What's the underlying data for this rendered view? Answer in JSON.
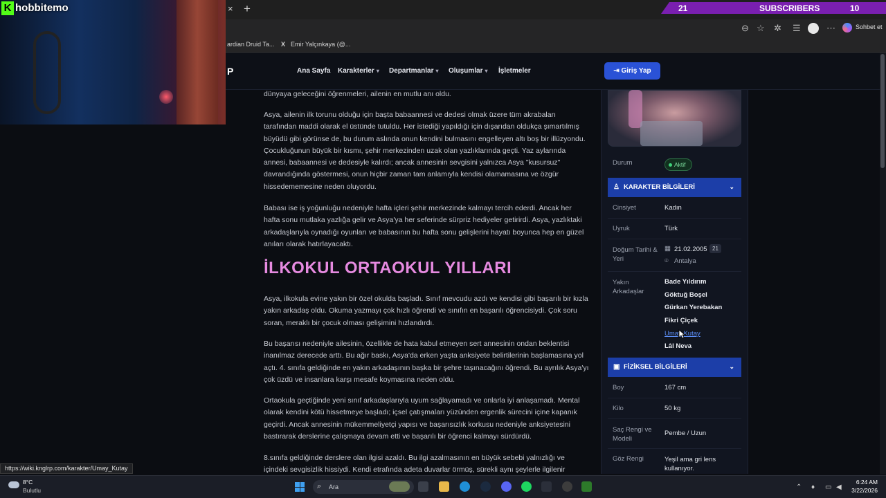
{
  "stream": {
    "channel": "hobbitemo",
    "banner": {
      "left": "21",
      "center": "SUBSCRIBERS",
      "right": "10"
    }
  },
  "browser": {
    "tab_close": "×",
    "tab_new": "+",
    "bookmarks": [
      "ardian Druid Ta...",
      "Emir Yalçınkaya (@..."
    ],
    "copilot_label": "Sohbet et",
    "status_url": "https://wiki.knglrp.com/karakter/Umay_Kutay"
  },
  "site": {
    "logo_fragment": "P",
    "nav": [
      {
        "label": "Ana Sayfa",
        "dropdown": false
      },
      {
        "label": "Karakterler",
        "dropdown": true
      },
      {
        "label": "Departmanlar",
        "dropdown": true
      },
      {
        "label": "Oluşumlar",
        "dropdown": true
      },
      {
        "label": "İşletmeler",
        "dropdown": false
      }
    ],
    "login_label": "Giriş Yap"
  },
  "article": {
    "paragraphs_top": [
      "dünyaya geleceğini öğrenmeleri, ailenin en mutlu anı oldu.",
      "Asya, ailenin ilk torunu olduğu için başta babaannesi ve dedesi olmak üzere tüm akrabaları tarafından maddi olarak el üstünde tutuldu. Her istediği yapıldığı için dışarıdan oldukça şımartılmış büyüdü gibi görünse de, bu durum aslında onun kendini bulmasını engelleyen altı boş bir illüzyondu. Çocukluğunun büyük bir kısmı, şehir merkezinden uzak olan yazlıklarında geçti. Yaz aylarında annesi, babaannesi ve dedesiyle kalırdı; ancak annesinin sevgisini yalnızca Asya \"kusursuz\" davrandığında göstermesi, onun hiçbir zaman tam anlamıyla kendisi olamamasına ve özgür hissedememesine neden oluyordu.",
      "Babası ise iş yoğunluğu nedeniyle hafta içleri şehir merkezinde kalmayı tercih ederdi. Ancak her hafta sonu mutlaka yazlığa gelir ve Asya'ya her seferinde sürpriz hediyeler getirirdi. Asya, yazlıktaki arkadaşlarıyla oynadığı oyunları ve babasının bu hafta sonu gelişlerini hayatı boyunca hep en güzel anıları olarak hatırlayacaktı."
    ],
    "section_title": "İLKOKUL ORTAOKUL YILLARI",
    "paragraphs_bottom": [
      "Asya, ilkokula evine yakın bir özel okulda başladı. Sınıf mevcudu azdı ve kendisi gibi başarılı bir kızla yakın arkadaş oldu. Okuma yazmayı çok hızlı öğrendi ve sınıfın en başarılı öğrencisiydi. Çok soru soran, meraklı bir çocuk olması gelişimini hızlandırdı.",
      "Bu başarısı nedeniyle ailesinin, özellikle de hata kabul etmeyen sert annesinin ondan beklentisi inanılmaz derecede arttı. Bu ağır baskı, Asya'da erken yaşta anksiyete belirtilerinin başlamasına yol açtı. 4. sınıfa geldiğinde en yakın arkadaşının başka bir şehre taşınacağını öğrendi. Bu ayrılık Asya'yı çok üzdü ve insanlara karşı mesafe koymasına neden oldu.",
      "Ortaokula geçtiğinde yeni sınıf arkadaşlarıyla uyum sağlayamadı ve onlarla iyi anlaşamadı. Mental olarak kendini kötü hissetmeye başladı; içsel çatışmaları yüzünden ergenlik sürecini içine kapanık geçirdi. Ancak annesinin mükemmeliyetçi yapısı ve başarısızlık korkusu nedeniyle anksiyetesini bastırarak derslerine çalışmaya devam etti ve başarılı bir öğrenci kalmayı sürdürdü.",
      "8.sınıfa geldiğinde derslere olan ilgisi azaldı. Bu ilgi azalmasının en büyük sebebi yalnızlığı ve içindeki sevgisizlik hissiydi. Kendi etrafında adeta duvarlar örmüş, sürekli aynı şeylerle ilgilenir"
    ]
  },
  "sidebar": {
    "status": {
      "label": "Durum",
      "value": "Aktif",
      "color": "#3fd27a"
    },
    "character_section": "KARAKTER BİLGİLERİ",
    "gender": {
      "label": "Cinsiyet",
      "value": "Kadın"
    },
    "nationality": {
      "label": "Uyruk",
      "value": "Türk"
    },
    "birth": {
      "label": "Doğum Tarihi & Yeri",
      "date": "21.02.2005",
      "age": "21",
      "place": "Antalya"
    },
    "friends": {
      "label": "Yakın Arkadaşlar",
      "items": [
        "Bade Yıldırım",
        "Göktuğ Boşel",
        "Gürkan Yerebakan",
        "Fikri Çiçek",
        "Umay Kutay",
        "Lâl Neva"
      ]
    },
    "physical_section": "FİZİKSEL BİLGİLERİ",
    "height": {
      "label": "Boy",
      "value": "167 cm"
    },
    "weight": {
      "label": "Kilo",
      "value": "50 kg"
    },
    "hair": {
      "label": "Saç Rengi ve Modeli",
      "value": "Pembe / Uzun"
    },
    "eyes": {
      "label": "Göz Rengi",
      "value": "Yeşil ama gri lens kullanıyor."
    }
  },
  "taskbar": {
    "weather_temp": "8°C",
    "weather_desc": "Bulutlu",
    "search_placeholder": "Ara",
    "time": "6:24 AM",
    "date": "3/22/2026"
  },
  "colors": {
    "accent": "#1c3ea8",
    "heading": "#e68ae0",
    "button": "#2a52d6",
    "banner": "#7a1fb0"
  }
}
